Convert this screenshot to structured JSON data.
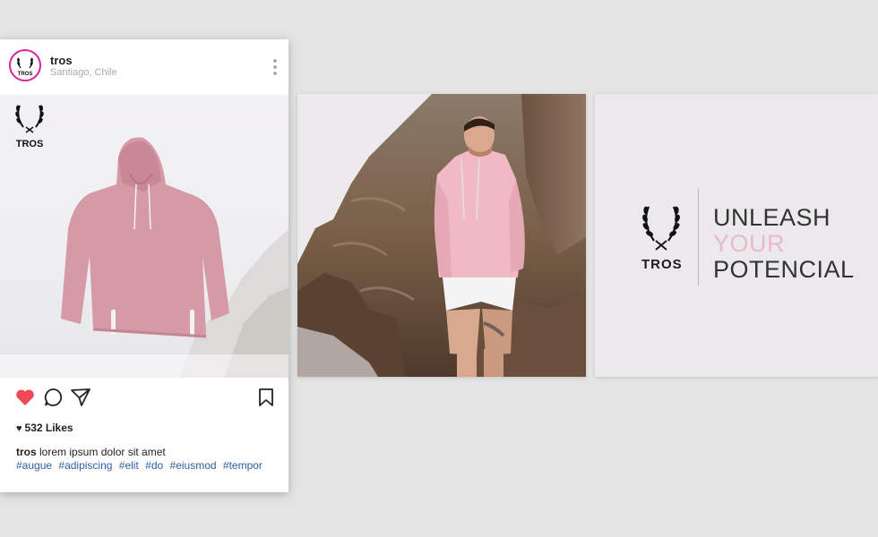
{
  "post": {
    "username": "tros",
    "location": "Santiago, Chile",
    "avatar_text": "TROS",
    "image_brand": "TROS",
    "likes_label": "532 Likes",
    "caption_user": "tros",
    "caption_text": " lorem ipsum dolor sit amet",
    "hashtags": [
      "#augue",
      "#adipiscing",
      "#elit",
      "#do",
      "#eiusmod",
      "#tempor"
    ],
    "icons": {
      "more": "more-vertical-icon",
      "like": "heart-icon",
      "comment": "comment-icon",
      "share": "send-icon",
      "save": "bookmark-icon"
    }
  },
  "brand_panel": {
    "wordmark": "TROS",
    "slogan": [
      "UNLEASH",
      "YOUR",
      "POTENCIAL"
    ]
  },
  "colors": {
    "background": "#e4e4e4",
    "heart": "#ed4956",
    "hashtag": "#2c5fa5",
    "accent_pink": "#e9b9c8",
    "avatar_ring": "#d6249f"
  }
}
